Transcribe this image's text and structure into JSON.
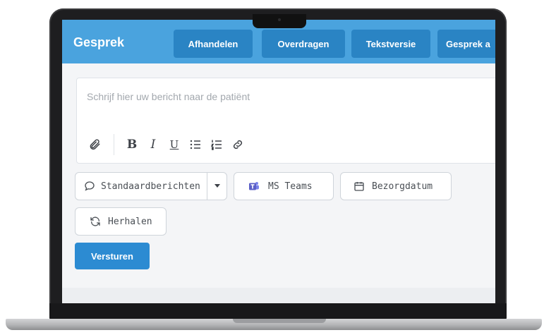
{
  "header": {
    "title": "Gesprek",
    "buttons": [
      "Afhandelen",
      "Overdragen",
      "Tekstversie",
      "Gesprek a"
    ]
  },
  "editor": {
    "placeholder": "Schrijf hier uw bericht naar de patiënt",
    "toolbar_icons": [
      "paperclip-icon",
      "bold-icon",
      "italic-icon",
      "underline-icon",
      "bullet-list-icon",
      "numbered-list-icon",
      "link-icon"
    ],
    "bold_glyph": "B",
    "italic_glyph": "I",
    "underline_glyph": "U"
  },
  "actions": {
    "standard_messages": "Standaardberichten",
    "ms_teams": "MS Teams",
    "delivery_date": "Bezorgdatum",
    "repeat": "Herhalen",
    "send": "Versturen"
  },
  "colors": {
    "header_bg": "#4aa3de",
    "header_button_bg": "#2a84c4",
    "send_button_bg": "#2c8bd2",
    "teams_purple": "#5b5fc7"
  }
}
